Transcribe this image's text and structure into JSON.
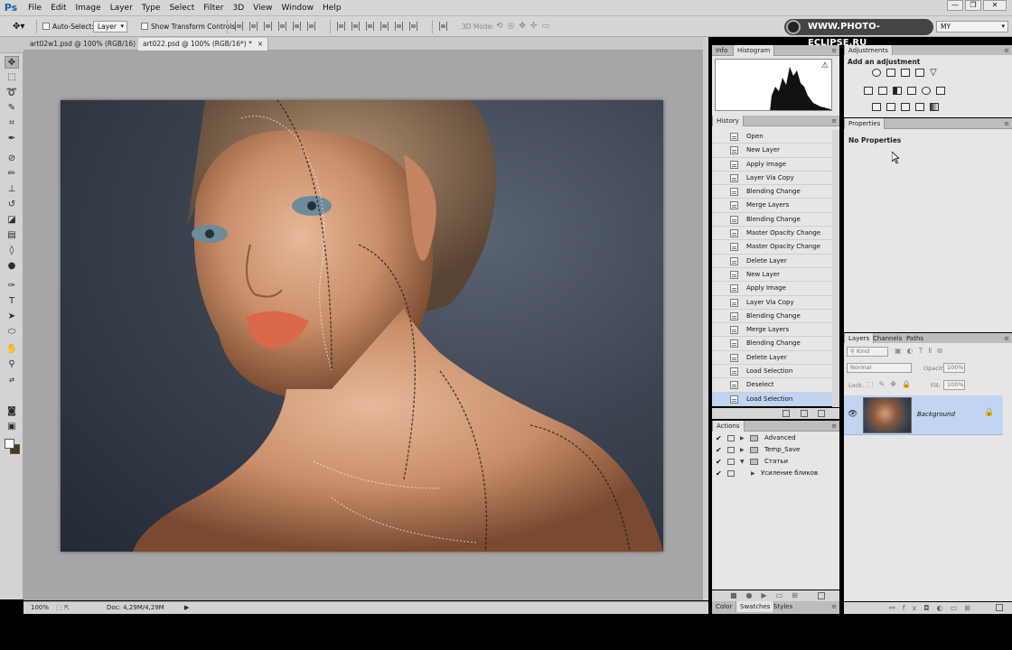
{
  "app": {
    "logo": "Ps"
  },
  "menu": [
    "File",
    "Edit",
    "Image",
    "Layer",
    "Type",
    "Select",
    "Filter",
    "3D",
    "View",
    "Window",
    "Help"
  ],
  "window_controls": {
    "minimize": "—",
    "restore": "❐",
    "close": "✕"
  },
  "options": {
    "auto_select_label": "Auto-Select:",
    "auto_select_value": "Layer",
    "show_transform_label": "Show Transform Controls",
    "mode_3d_label": "3D Mode:",
    "watermark": "WWW.PHOTO-ECLIPSE.RU",
    "workspace": "MY"
  },
  "doc_tabs": [
    {
      "label": "art02w1.psd @ 100% (RGB/16)",
      "close": "×"
    },
    {
      "label": "art022.psd @ 100% (RGB/16*) *",
      "close": "×"
    }
  ],
  "status": {
    "zoom": "100%",
    "doc": "Doc: 4,29M/4,29M"
  },
  "panels": {
    "info_tab": "Info",
    "histogram_tab": "Histogram",
    "history_tab": "History",
    "actions_tab": "Actions",
    "color_tab": "Color",
    "swatches_tab": "Swatches",
    "styles_tab": "Styles",
    "adjustments_tab": "Adjustments",
    "add_adjustment": "Add an adjustment",
    "properties_tab": "Properties",
    "no_properties": "No Properties",
    "layers_tab": "Layers",
    "channels_tab": "Channels",
    "paths_tab": "Paths",
    "histogram_warning": "⚠"
  },
  "history": [
    "Open",
    "New Layer",
    "Apply Image",
    "Layer Via Copy",
    "Blending Change",
    "Merge Layers",
    "Blending Change",
    "Master Opacity Change",
    "Master Opacity Change",
    "Delete Layer",
    "New Layer",
    "Apply Image",
    "Layer Via Copy",
    "Blending Change",
    "Merge Layers",
    "Blending Change",
    "Delete Layer",
    "Load Selection",
    "Deselect",
    "Load Selection"
  ],
  "actions": [
    {
      "label": "Advanced",
      "check": "✔"
    },
    {
      "label": "Temp_Save",
      "check": "✔"
    },
    {
      "label": "Статьи",
      "check": "✔"
    },
    {
      "label": "Усиление бликов",
      "check": "✔"
    }
  ],
  "layers": {
    "kind": "Kind",
    "blend": "Normal",
    "opacity_label": "Opacity:",
    "opacity": "100%",
    "lock_label": "Lock:",
    "fill_label": "Fill:",
    "fill": "100%",
    "items": [
      {
        "name": "Background"
      }
    ]
  }
}
